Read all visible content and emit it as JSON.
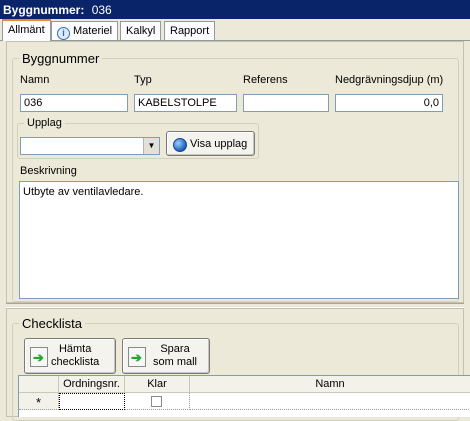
{
  "window": {
    "title_label": "Byggnummer:",
    "title_value": "036"
  },
  "tabs": [
    {
      "label": "Allmänt",
      "active": true
    },
    {
      "label": "Materiel",
      "icon": "info-icon"
    },
    {
      "label": "Kalkyl"
    },
    {
      "label": "Rapport"
    }
  ],
  "byggnummer": {
    "legend": "Byggnummer",
    "fields": {
      "namn": {
        "label": "Namn",
        "value": "036"
      },
      "typ": {
        "label": "Typ",
        "value": "KABELSTOLPE"
      },
      "referens": {
        "label": "Referens",
        "value": ""
      },
      "djup": {
        "label": "Nedgrävningsdjup (m)",
        "value": "0,0"
      }
    },
    "upplag": {
      "legend": "Upplag",
      "selected": "",
      "button_label": "Visa upplag"
    },
    "beskrivning": {
      "label": "Beskrivning",
      "value": "Utbyte av ventilavledare."
    }
  },
  "checklista": {
    "legend": "Checklista",
    "buttons": [
      {
        "label_line1": "Hämta",
        "label_line2": "checklista",
        "icon": "import-icon"
      },
      {
        "label_line1": "Spara",
        "label_line2": "som mall",
        "icon": "save-icon"
      }
    ],
    "grid": {
      "columns": [
        "",
        "Ordningsnr.",
        "Klar",
        "Namn"
      ],
      "new_row_marker": "*"
    }
  }
}
